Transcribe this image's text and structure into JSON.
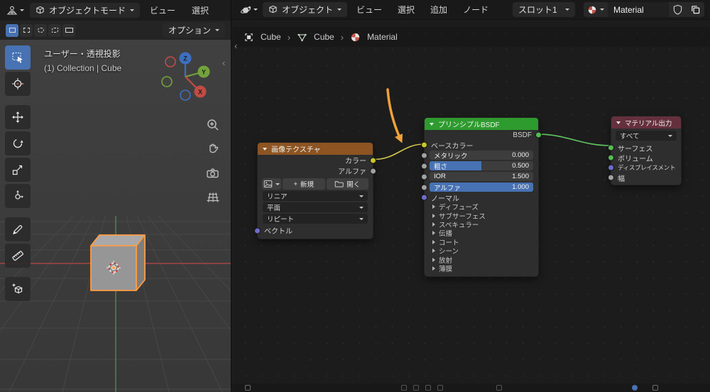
{
  "icons": {
    "breadcrumb_sep": "›",
    "collapse_left": "‹",
    "plus": "+"
  },
  "viewport": {
    "header": {
      "mode": "オブジェクトモード",
      "menu_view": "ビュー",
      "menu_select": "選択"
    },
    "toolrow": {
      "options": "オプション"
    },
    "overlay": {
      "view": "ユーザー・透視投影",
      "collection": "(1) Collection | Cube"
    },
    "gizmo": {
      "x": "X",
      "y": "Y",
      "z": "Z"
    }
  },
  "shader": {
    "header": {
      "type": "オブジェクト",
      "menu_view": "ビュー",
      "menu_select": "選択",
      "menu_add": "追加",
      "menu_node": "ノード",
      "slot": "スロット1",
      "material": "Material"
    },
    "breadcrumb": {
      "object": "Cube",
      "mesh": "Cube",
      "material": "Material"
    },
    "image_texture": {
      "title": "画像テクスチャ",
      "out_color": "カラー",
      "out_alpha": "アルファ",
      "btn_new": "新規",
      "btn_open": "開く",
      "interpolation": "リニア",
      "projection": "平面",
      "extension": "リピート",
      "in_vector": "ベクトル"
    },
    "principled": {
      "title": "プリンシプルBSDF",
      "out_bsdf": "BSDF",
      "in_base_color": "ベースカラー",
      "sliders": [
        {
          "label": "メタリック",
          "value": "0.000"
        },
        {
          "label": "粗さ",
          "value": "0.500"
        },
        {
          "label": "IOR",
          "value": "1.500"
        },
        {
          "label": "アルファ",
          "value": "1.000"
        }
      ],
      "in_normal": "ノーマル",
      "panels": [
        "ディフューズ",
        "サブサーフェス",
        "スペキュラー",
        "伝播",
        "コート",
        "シーン",
        "放射",
        "薄膜"
      ]
    },
    "output": {
      "title": "マテリアル出力",
      "target": "すべて",
      "in_surface": "サーフェス",
      "in_volume": "ボリューム",
      "in_displacement": "ディスプレイスメント",
      "in_thickness": "幅"
    }
  },
  "colors": {
    "accent": "#4772b3",
    "image_node_header": "#8e5422",
    "shader_node_header": "#2e9b2e",
    "output_node_header": "#65303e",
    "color_wire": "#d4c84f",
    "shader_wire": "#63c763",
    "annotation": "#f0a13a"
  }
}
